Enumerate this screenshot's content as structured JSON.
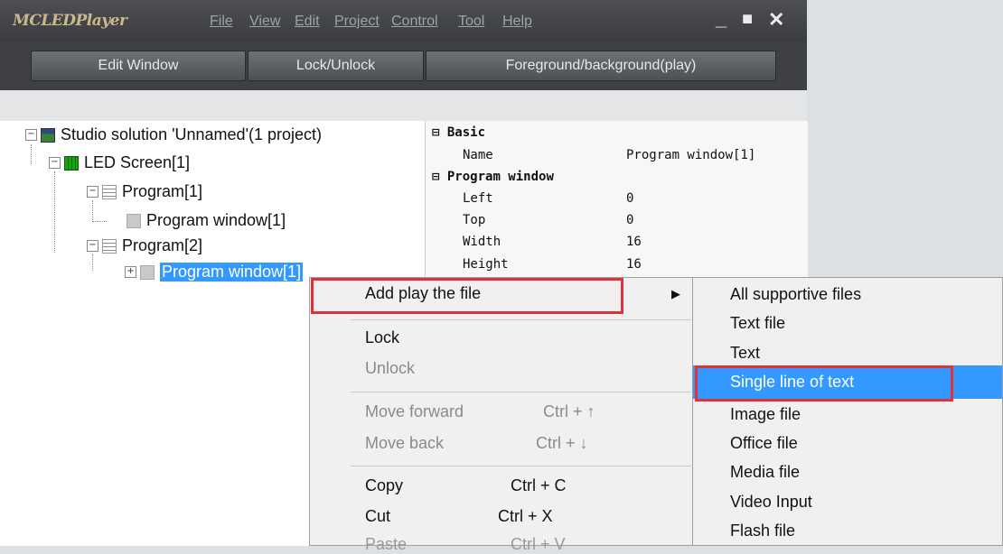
{
  "app": {
    "logo": "MCLEDPlayer",
    "menu": [
      "File",
      "View",
      "Edit",
      "Project",
      "Control",
      "Tool",
      "Help"
    ],
    "buttons": {
      "minimize": "_",
      "maximize": "■",
      "close": "✕"
    }
  },
  "toolbar": {
    "edit_window": "Edit Window",
    "lock_unlock": "Lock/Unlock",
    "foreground": "Foreground/background(play)"
  },
  "tree": {
    "solution": "Studio solution 'Unnamed'(1 project)",
    "led_screen": "LED Screen[1]",
    "program1": "Program[1]",
    "program1_window": "Program window[1]",
    "program2": "Program[2]",
    "program2_window": "Program window[1]"
  },
  "properties": {
    "basic": "Basic",
    "name_label": "Name",
    "name_value": "Program window[1]",
    "program_window": "Program window",
    "left_label": "Left",
    "left_value": "0",
    "top_label": "Top",
    "top_value": "0",
    "width_label": "Width",
    "width_value": "16",
    "height_label": "Height",
    "height_value": "16"
  },
  "context_menu": {
    "add_play_file": "Add play the file",
    "lock": "Lock",
    "unlock": "Unlock",
    "move_forward": "Move forward",
    "move_forward_shortcut": "Ctrl + ↑",
    "move_back": "Move back",
    "move_back_shortcut": "Ctrl + ↓",
    "copy": "Copy",
    "copy_shortcut": "Ctrl + C",
    "cut": "Cut",
    "cut_shortcut": "Ctrl + X",
    "paste": "Paste",
    "paste_shortcut": "Ctrl + V"
  },
  "submenu": {
    "items": [
      "All supportive files",
      "Text file",
      "Text",
      "Single line of text",
      "Image file",
      "Office file",
      "Media file",
      "Video Input",
      "Flash file"
    ]
  },
  "colors": {
    "highlight": "#3399ff",
    "callout": "#e0323a"
  }
}
